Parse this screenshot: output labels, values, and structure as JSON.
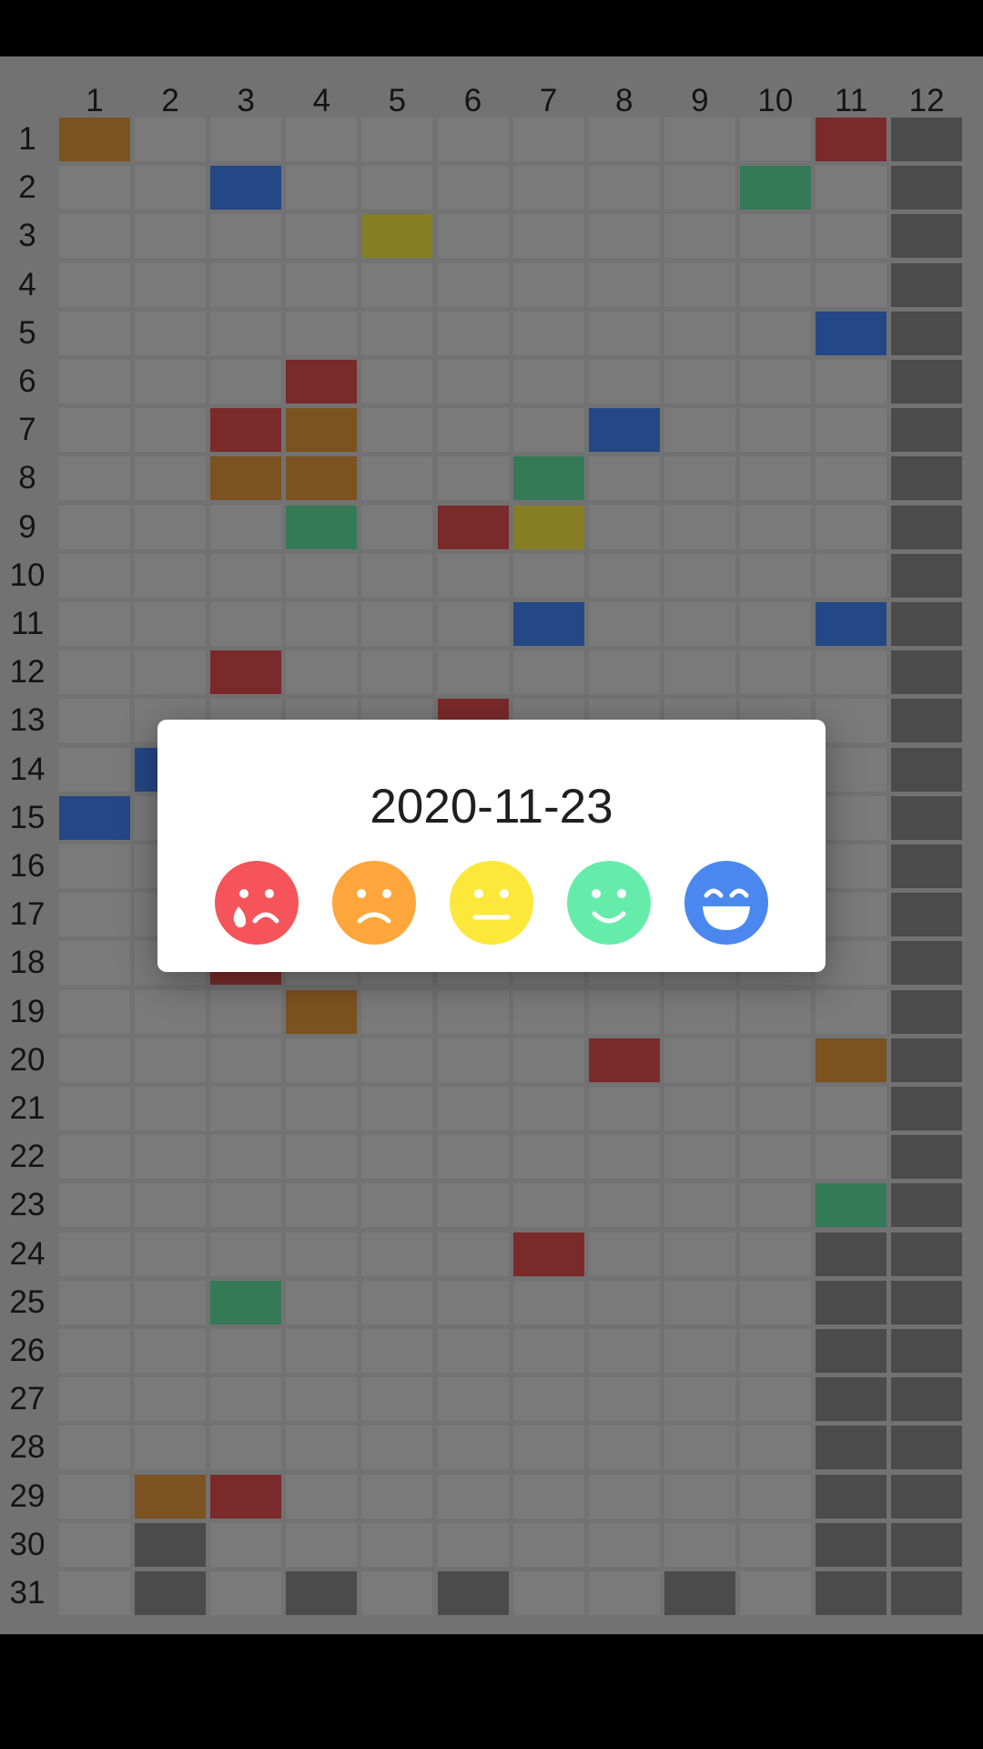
{
  "columns": [
    "1",
    "2",
    "3",
    "4",
    "5",
    "6",
    "7",
    "8",
    "9",
    "10",
    "11",
    "12"
  ],
  "rows": [
    "1",
    "2",
    "3",
    "4",
    "5",
    "6",
    "7",
    "8",
    "9",
    "10",
    "11",
    "12",
    "13",
    "14",
    "15",
    "16",
    "17",
    "18",
    "19",
    "20",
    "21",
    "22",
    "23",
    "24",
    "25",
    "26",
    "27",
    "28",
    "29",
    "30",
    "31"
  ],
  "mood_colors": {
    "very_sad": "#7a2a2a",
    "sad": "#7c5220",
    "neutral": "#857e22",
    "happy": "#357a57",
    "very_happy": "#244785",
    "no_day": "#4b4b4b"
  },
  "entries": [
    {
      "day": "1",
      "month": "1",
      "mood": "sad"
    },
    {
      "day": "1",
      "month": "11",
      "mood": "very_sad"
    },
    {
      "day": "2",
      "month": "3",
      "mood": "very_happy"
    },
    {
      "day": "2",
      "month": "10",
      "mood": "happy"
    },
    {
      "day": "3",
      "month": "5",
      "mood": "neutral"
    },
    {
      "day": "5",
      "month": "11",
      "mood": "very_happy"
    },
    {
      "day": "6",
      "month": "4",
      "mood": "very_sad"
    },
    {
      "day": "7",
      "month": "3",
      "mood": "very_sad"
    },
    {
      "day": "7",
      "month": "4",
      "mood": "sad"
    },
    {
      "day": "7",
      "month": "8",
      "mood": "very_happy"
    },
    {
      "day": "8",
      "month": "3",
      "mood": "sad"
    },
    {
      "day": "8",
      "month": "4",
      "mood": "sad"
    },
    {
      "day": "8",
      "month": "7",
      "mood": "happy"
    },
    {
      "day": "9",
      "month": "4",
      "mood": "happy"
    },
    {
      "day": "9",
      "month": "6",
      "mood": "very_sad"
    },
    {
      "day": "9",
      "month": "7",
      "mood": "neutral"
    },
    {
      "day": "11",
      "month": "7",
      "mood": "very_happy"
    },
    {
      "day": "11",
      "month": "11",
      "mood": "very_happy"
    },
    {
      "day": "12",
      "month": "3",
      "mood": "very_sad"
    },
    {
      "day": "13",
      "month": "6",
      "mood": "very_sad"
    },
    {
      "day": "14",
      "month": "2",
      "mood": "very_happy"
    },
    {
      "day": "15",
      "month": "1",
      "mood": "very_happy"
    },
    {
      "day": "18",
      "month": "3",
      "mood": "very_sad"
    },
    {
      "day": "19",
      "month": "4",
      "mood": "sad"
    },
    {
      "day": "20",
      "month": "8",
      "mood": "very_sad"
    },
    {
      "day": "20",
      "month": "11",
      "mood": "sad"
    },
    {
      "day": "23",
      "month": "11",
      "mood": "happy"
    },
    {
      "day": "24",
      "month": "7",
      "mood": "very_sad"
    },
    {
      "day": "25",
      "month": "3",
      "mood": "happy"
    },
    {
      "day": "29",
      "month": "2",
      "mood": "sad"
    },
    {
      "day": "29",
      "month": "3",
      "mood": "very_sad"
    }
  ],
  "dialog": {
    "date": "2020-11-23",
    "mood_options": [
      {
        "name": "crying-face-icon",
        "color": "#f5545a"
      },
      {
        "name": "sad-face-icon",
        "color": "#fda63b"
      },
      {
        "name": "neutral-face-icon",
        "color": "#fce83a"
      },
      {
        "name": "smiling-face-icon",
        "color": "#66ecaa"
      },
      {
        "name": "grinning-face-icon",
        "color": "#4a88f0"
      }
    ]
  }
}
